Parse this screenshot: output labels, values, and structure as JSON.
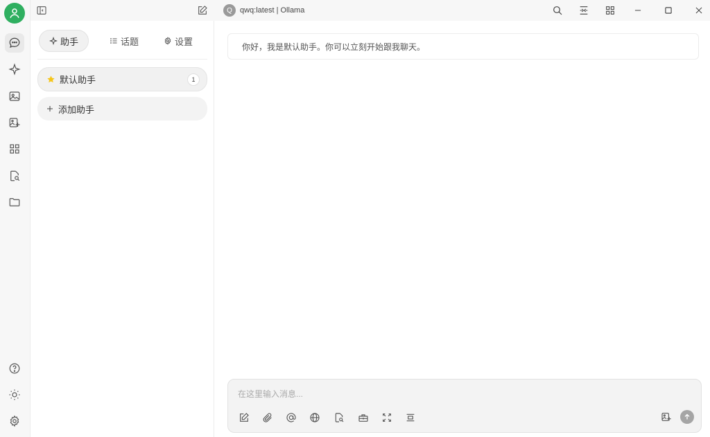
{
  "window": {
    "model_chip": {
      "logo_letter": "Q",
      "label": "qwq:latest | Ollama"
    }
  },
  "rail": {
    "items": [
      {
        "name": "chat",
        "icon": "chat-bubble-icon",
        "active": true
      },
      {
        "name": "agents",
        "icon": "sparkle-icon"
      },
      {
        "name": "images",
        "icon": "image-icon"
      },
      {
        "name": "translate",
        "icon": "image-edit-icon"
      },
      {
        "name": "apps",
        "icon": "grid-icon"
      },
      {
        "name": "knowledge",
        "icon": "doc-search-icon"
      },
      {
        "name": "files",
        "icon": "folder-icon"
      }
    ],
    "bottom": [
      {
        "name": "help",
        "icon": "help-icon"
      },
      {
        "name": "theme",
        "icon": "sun-icon"
      },
      {
        "name": "settings",
        "icon": "gear-icon"
      }
    ]
  },
  "panel": {
    "tabs": [
      {
        "label": "助手",
        "icon": "sparkle-icon",
        "active": true
      },
      {
        "label": "话题",
        "icon": "list-icon"
      },
      {
        "label": "设置",
        "icon": "gear-icon"
      }
    ],
    "assistant": {
      "label": "默认助手",
      "icon": "star-icon",
      "count": "1"
    },
    "add_assistant": {
      "label": "添加助手",
      "icon": "plus-icon"
    }
  },
  "chat": {
    "welcome": "你好，我是默认助手。你可以立刻开始跟我聊天。"
  },
  "composer": {
    "placeholder": "在这里输入消息...",
    "value": "",
    "tools": [
      "edit-icon",
      "paperclip-icon",
      "at-icon",
      "globe-icon",
      "doc-search-icon",
      "toolbox-icon",
      "expand-icon",
      "clear-icon"
    ],
    "accent": "#2faf60"
  }
}
